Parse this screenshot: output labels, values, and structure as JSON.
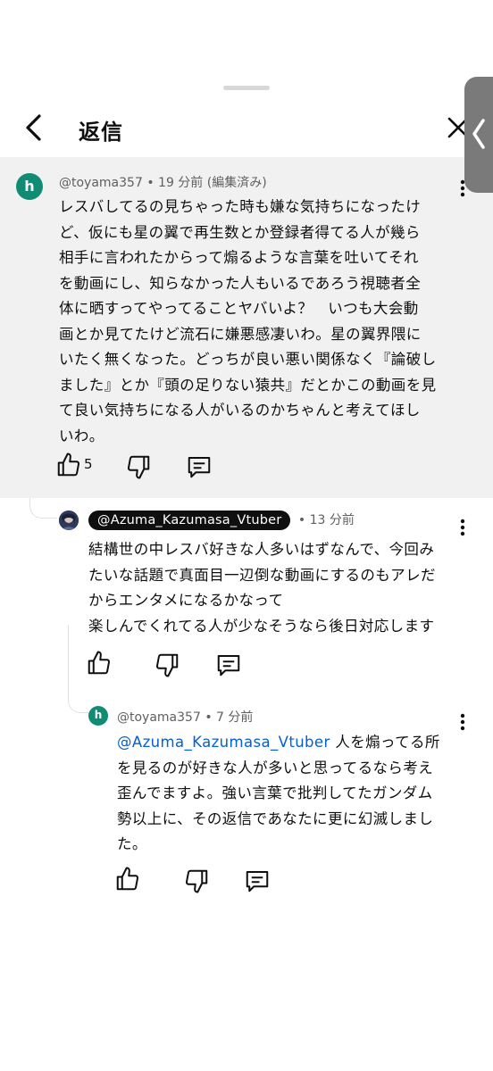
{
  "header": {
    "title": "返信"
  },
  "comment": {
    "author": "@toyama357",
    "time": "19 分前 (編集済み)",
    "avatar_letter": "h",
    "text_lines": [
      "レスバしてるの見ちゃった時も嫌な気持ちになったけ",
      "ど、仮にも星の翼で再生数とか登録者得てる人が幾ら",
      "相手に言われたからって煽るような言葉を吐いてそれ",
      "を動画にし、知らなかった人もいるであろう視聴者全",
      "体に晒すってやってることヤバいよ？　いつも大会動",
      "画とか見てたけど流石に嫌悪感凄いわ。星の翼界隈に",
      "いたく無くなった。どっちが良い悪い関係なく『論破し",
      "ました』とか『頭の足りない猿共』だとかこの動画を見",
      "て良い気持ちになる人がいるのかちゃんと考えてほし",
      "いわ。"
    ],
    "like_count": "5"
  },
  "reply1": {
    "author": "@Azuma_Kazumasa_Vtuber",
    "time": "• 13 分前",
    "text_lines": [
      "結構世の中レスバ好きな人多いはずなんで、今回み",
      "たいな話題で真面目一辺倒な動画にするのもアレだ",
      "からエンタメになるかなって",
      "楽しんでくれてる人が少なそうなら後日対応します"
    ]
  },
  "reply2": {
    "author": "@toyama357",
    "time": "• 7 分前",
    "avatar_letter": "h",
    "mention": "@Azuma_Kazumasa_Vtuber",
    "text_first_rest": " 人を煽ってる所",
    "text_lines": [
      "を見るのが好きな人が多いと思ってるなら考え",
      "歪んでますよ。強い言葉で批判してたガンダム",
      "勢以上に、その返信であなたに更に幻滅しまし",
      "た。"
    ]
  },
  "colors": {
    "avatar_green": "#0f8c73",
    "mention_blue": "#065fd4",
    "highlight_bg": "#f1f1f1"
  }
}
